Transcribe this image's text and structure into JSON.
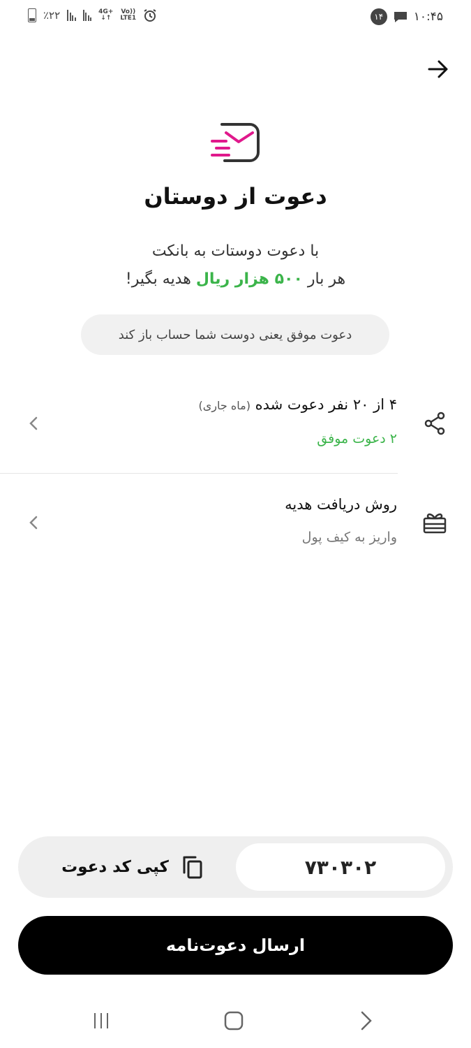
{
  "status_bar": {
    "battery_text": "٪۲۲",
    "network_4g": "4G+",
    "network_volte": "Vo))",
    "network_lte": "LTE1",
    "notification_count": "۱۴",
    "time": "۱۰:۴۵"
  },
  "header": {
    "title": "دعوت از دوستان"
  },
  "description": {
    "line1": "با دعوت دوستات به بانکت",
    "line2_prefix": "هر بار ",
    "line2_highlight": "۵۰۰ هزار ریال",
    "line2_suffix": " هدیه بگیر!"
  },
  "info_pill": "دعوت موفق یعنی دوست شما حساب باز کند",
  "invites_row": {
    "title": "۴ از ۲۰ نفر دعوت شده",
    "title_note": "(ماه جاری)",
    "subtitle": "۲ دعوت موفق",
    "icon": "share-icon"
  },
  "gift_row": {
    "title": "روش دریافت هدیه",
    "subtitle": "واریز به کیف پول",
    "icon": "gift-icon"
  },
  "invite_code": {
    "code": "۷۳۰۳۰۲",
    "copy_label": "کپی کد دعوت"
  },
  "send_button": "ارسال دعوت‌نامه",
  "colors": {
    "accent_green": "#3bb44a",
    "brand_pink": "#e0198c",
    "button_black": "#000000"
  }
}
